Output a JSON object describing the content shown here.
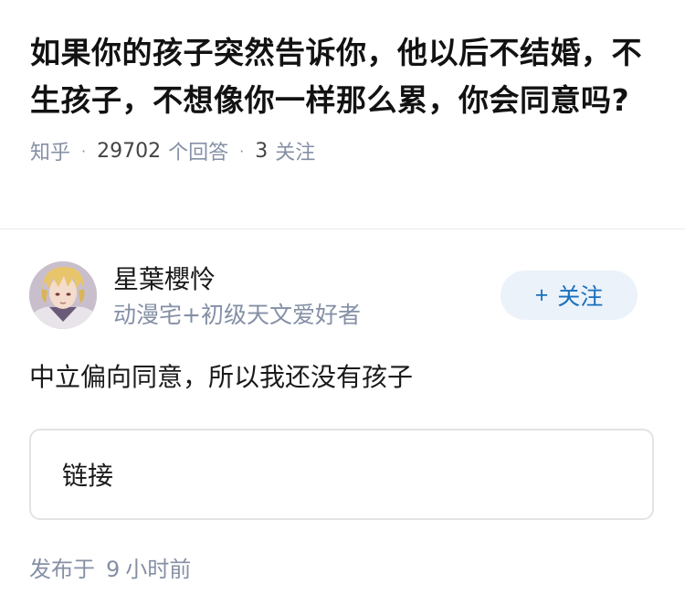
{
  "question": {
    "title": "如果你的孩子突然告诉你，他以后不结婚，不生孩子，不想像你一样那么累，你会同意吗?",
    "source": "知乎",
    "answer_count": "29702",
    "answer_count_label": "个回答",
    "follow_count": "3",
    "follow_count_label": "关注",
    "separator": "·"
  },
  "answer": {
    "author": {
      "name": "星葉櫻怜",
      "bio": "动漫宅+初级天文爱好者",
      "avatar_icon": "anime-avatar"
    },
    "follow_button": {
      "icon": "+",
      "label": "关注"
    },
    "content": "中立偏向同意，所以我还没有孩子",
    "link_card": {
      "label": "链接"
    },
    "publish_prefix": "发布于",
    "publish_number": "9",
    "publish_suffix": "小时前"
  },
  "colors": {
    "meta_gray": "#8590a6",
    "accent_blue": "#1a6fbd",
    "follow_bg": "#ebf2fa"
  }
}
